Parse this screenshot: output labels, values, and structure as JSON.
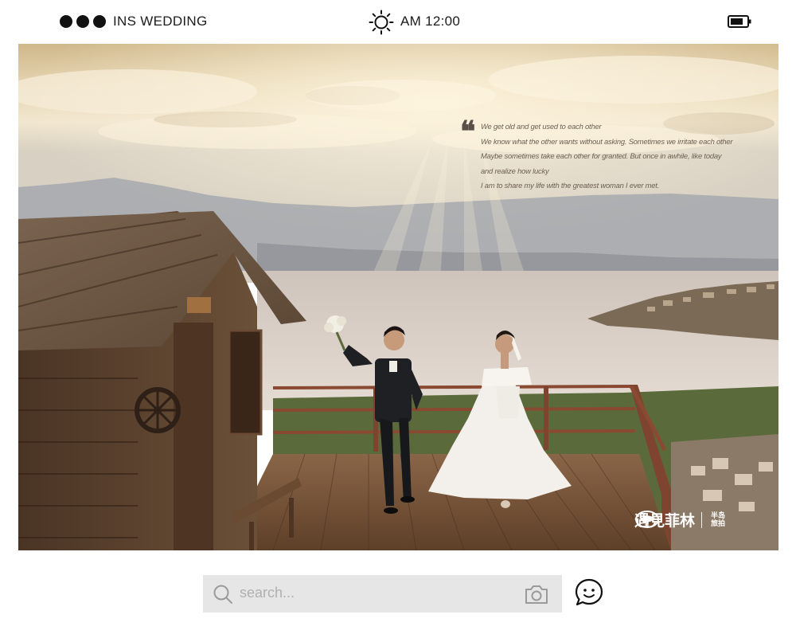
{
  "status_bar": {
    "app_title": "INS WEDDING",
    "time": "AM 12:00",
    "icons": [
      "window-dots",
      "sun-icon",
      "battery-icon"
    ]
  },
  "photo": {
    "quote_lines": [
      "We get old and get used to each other",
      "We know what the other wants without asking. Sometimes we irritate each other",
      "Maybe sometimes take each other for granted. But once in awhile, like today",
      "and realize how lucky",
      "I am to share my life with the greatest woman I ever met."
    ],
    "watermark": {
      "brand": "遇見菲林",
      "partner": "半岛旅拍"
    }
  },
  "search": {
    "placeholder": "search..."
  },
  "colors": {
    "dot": "#111111",
    "search_bg": "#e6e6e6",
    "placeholder": "#b0b0b0"
  }
}
